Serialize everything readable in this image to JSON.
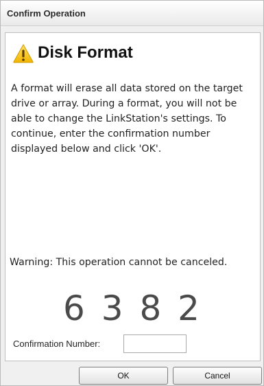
{
  "dialog": {
    "title": "Confirm Operation"
  },
  "content": {
    "heading": "Disk Format",
    "heading_icon": "warning-triangle-icon",
    "description": "A format will erase all data stored on the target drive or array. During a format, you will not be able to change the LinkStation's settings. To continue, enter the confirmation number displayed below and click 'OK'.",
    "warning": "Warning: This operation cannot be canceled.",
    "confirmation_digits": "6 3 8 2",
    "confirmation_label": "Confirmation Number:",
    "confirmation_value": ""
  },
  "buttons": {
    "ok_label": "OK",
    "cancel_label": "Cancel"
  },
  "colors": {
    "warning_icon_fill": "#f7c815",
    "warning_icon_mark": "#5a3c00",
    "dialog_background": "#f0f0f0",
    "content_background": "#ffffff"
  }
}
